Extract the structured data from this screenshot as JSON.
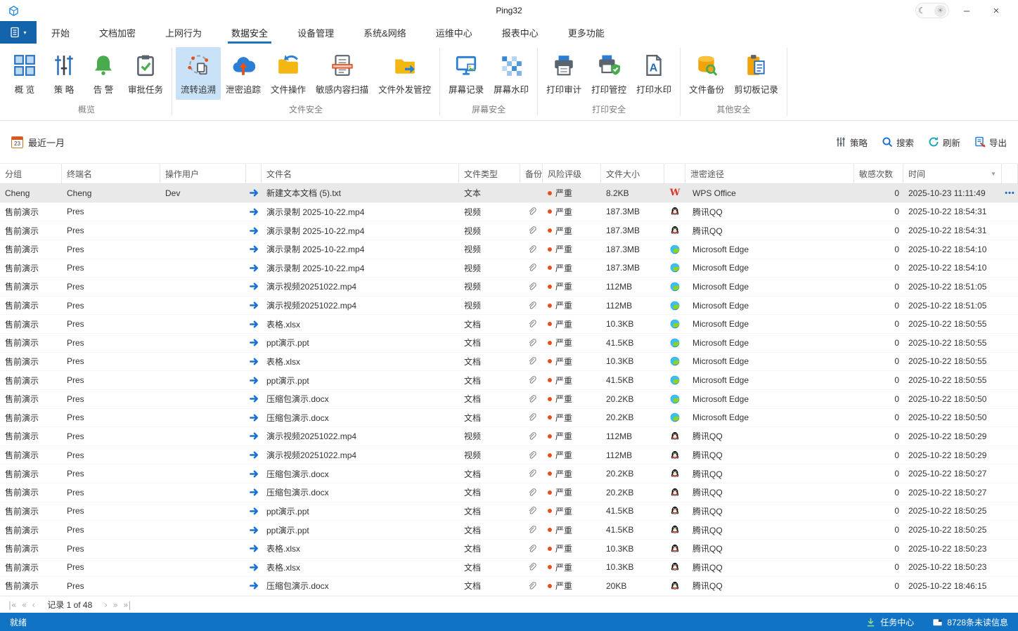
{
  "window": {
    "title": "Ping32",
    "minimize_glyph": "–",
    "close_glyph": "×"
  },
  "tabs": [
    {
      "label": "开始"
    },
    {
      "label": "文档加密"
    },
    {
      "label": "上网行为"
    },
    {
      "label": "数据安全",
      "active": true
    },
    {
      "label": "设备管理"
    },
    {
      "label": "系统&网络"
    },
    {
      "label": "运维中心"
    },
    {
      "label": "报表中心"
    },
    {
      "label": "更多功能"
    }
  ],
  "ribbon": {
    "groups": [
      {
        "name": "概览",
        "buttons": [
          {
            "label": "概 览",
            "icon": "overview-grid-icon"
          },
          {
            "label": "策 略",
            "icon": "policy-sliders-icon"
          },
          {
            "label": "告 警",
            "icon": "alert-bell-icon"
          },
          {
            "label": "审批任务",
            "icon": "approval-tasks-icon"
          }
        ]
      },
      {
        "name": "文件安全",
        "buttons": [
          {
            "label": "流转追溯",
            "icon": "flow-trace-icon",
            "selected": true
          },
          {
            "label": "泄密追踪",
            "icon": "leak-trace-icon"
          },
          {
            "label": "文件操作",
            "icon": "file-operations-icon"
          },
          {
            "label": "敏感内容扫描",
            "icon": "sensitive-scan-icon"
          },
          {
            "label": "文件外发管控",
            "icon": "file-outgoing-icon"
          }
        ]
      },
      {
        "name": "屏幕安全",
        "buttons": [
          {
            "label": "屏幕记录",
            "icon": "screen-record-icon"
          },
          {
            "label": "屏幕水印",
            "icon": "screen-watermark-icon"
          }
        ]
      },
      {
        "name": "打印安全",
        "buttons": [
          {
            "label": "打印审计",
            "icon": "print-audit-icon"
          },
          {
            "label": "打印管控",
            "icon": "print-control-icon"
          },
          {
            "label": "打印水印",
            "icon": "print-watermark-icon"
          }
        ]
      },
      {
        "name": "其他安全",
        "buttons": [
          {
            "label": "文件备份",
            "icon": "file-backup-icon"
          },
          {
            "label": "剪切板记录",
            "icon": "clipboard-record-icon"
          }
        ]
      }
    ]
  },
  "filter_bar": {
    "calendar_day": "23",
    "date_range": "最近一月",
    "actions": [
      {
        "label": "策略",
        "icon": "policy-filter-icon"
      },
      {
        "label": "搜索",
        "icon": "search-icon"
      },
      {
        "label": "刷新",
        "icon": "refresh-icon"
      },
      {
        "label": "导出",
        "icon": "export-icon"
      }
    ]
  },
  "table": {
    "columns": [
      {
        "label": "分组"
      },
      {
        "label": "终端名"
      },
      {
        "label": "操作用户"
      },
      {
        "label": ""
      },
      {
        "label": "文件名"
      },
      {
        "label": "文件类型"
      },
      {
        "label": "备份"
      },
      {
        "label": "风险评级"
      },
      {
        "label": "文件大小"
      },
      {
        "label": ""
      },
      {
        "label": "泄密途径"
      },
      {
        "label": "敏感次数"
      },
      {
        "label": "时间",
        "filter": true
      },
      {
        "label": ""
      }
    ],
    "rows": [
      {
        "group": "Cheng",
        "terminal": "Cheng",
        "user": "Dev",
        "file": "新建文本文档 (5).txt",
        "type": "文本",
        "backup": false,
        "risk": "严重",
        "size": "8.2KB",
        "channel": "WPS Office",
        "channel_icon": "wps-office-icon",
        "count": "0",
        "time": "2025-10-23 11:11:49",
        "selected": true,
        "more": true
      },
      {
        "group": "售前演示",
        "terminal": "Pres",
        "user": "",
        "file": "演示录制 2025-10-22.mp4",
        "type": "视频",
        "backup": true,
        "risk": "严重",
        "size": "187.3MB",
        "channel": "腾讯QQ",
        "channel_icon": "qq-icon",
        "count": "0",
        "time": "2025-10-22 18:54:31"
      },
      {
        "group": "售前演示",
        "terminal": "Pres",
        "user": "",
        "file": "演示录制 2025-10-22.mp4",
        "type": "视频",
        "backup": true,
        "risk": "严重",
        "size": "187.3MB",
        "channel": "腾讯QQ",
        "channel_icon": "qq-icon",
        "count": "0",
        "time": "2025-10-22 18:54:31"
      },
      {
        "group": "售前演示",
        "terminal": "Pres",
        "user": "",
        "file": "演示录制 2025-10-22.mp4",
        "type": "视频",
        "backup": true,
        "risk": "严重",
        "size": "187.3MB",
        "channel": "Microsoft Edge",
        "channel_icon": "edge-icon",
        "count": "0",
        "time": "2025-10-22 18:54:10"
      },
      {
        "group": "售前演示",
        "terminal": "Pres",
        "user": "",
        "file": "演示录制 2025-10-22.mp4",
        "type": "视频",
        "backup": true,
        "risk": "严重",
        "size": "187.3MB",
        "channel": "Microsoft Edge",
        "channel_icon": "edge-icon",
        "count": "0",
        "time": "2025-10-22 18:54:10"
      },
      {
        "group": "售前演示",
        "terminal": "Pres",
        "user": "",
        "file": "演示视频20251022.mp4",
        "type": "视频",
        "backup": true,
        "risk": "严重",
        "size": "112MB",
        "channel": "Microsoft Edge",
        "channel_icon": "edge-icon",
        "count": "0",
        "time": "2025-10-22 18:51:05"
      },
      {
        "group": "售前演示",
        "terminal": "Pres",
        "user": "",
        "file": "演示视频20251022.mp4",
        "type": "视频",
        "backup": true,
        "risk": "严重",
        "size": "112MB",
        "channel": "Microsoft Edge",
        "channel_icon": "edge-icon",
        "count": "0",
        "time": "2025-10-22 18:51:05"
      },
      {
        "group": "售前演示",
        "terminal": "Pres",
        "user": "",
        "file": "表格.xlsx",
        "type": "文档",
        "backup": true,
        "risk": "严重",
        "size": "10.3KB",
        "channel": "Microsoft Edge",
        "channel_icon": "edge-icon",
        "count": "0",
        "time": "2025-10-22 18:50:55"
      },
      {
        "group": "售前演示",
        "terminal": "Pres",
        "user": "",
        "file": "ppt演示.ppt",
        "type": "文档",
        "backup": true,
        "risk": "严重",
        "size": "41.5KB",
        "channel": "Microsoft Edge",
        "channel_icon": "edge-icon",
        "count": "0",
        "time": "2025-10-22 18:50:55"
      },
      {
        "group": "售前演示",
        "terminal": "Pres",
        "user": "",
        "file": "表格.xlsx",
        "type": "文档",
        "backup": true,
        "risk": "严重",
        "size": "10.3KB",
        "channel": "Microsoft Edge",
        "channel_icon": "edge-icon",
        "count": "0",
        "time": "2025-10-22 18:50:55"
      },
      {
        "group": "售前演示",
        "terminal": "Pres",
        "user": "",
        "file": "ppt演示.ppt",
        "type": "文档",
        "backup": true,
        "risk": "严重",
        "size": "41.5KB",
        "channel": "Microsoft Edge",
        "channel_icon": "edge-icon",
        "count": "0",
        "time": "2025-10-22 18:50:55"
      },
      {
        "group": "售前演示",
        "terminal": "Pres",
        "user": "",
        "file": "压缩包演示.docx",
        "type": "文档",
        "backup": true,
        "risk": "严重",
        "size": "20.2KB",
        "channel": "Microsoft Edge",
        "channel_icon": "edge-icon",
        "count": "0",
        "time": "2025-10-22 18:50:50"
      },
      {
        "group": "售前演示",
        "terminal": "Pres",
        "user": "",
        "file": "压缩包演示.docx",
        "type": "文档",
        "backup": true,
        "risk": "严重",
        "size": "20.2KB",
        "channel": "Microsoft Edge",
        "channel_icon": "edge-icon",
        "count": "0",
        "time": "2025-10-22 18:50:50"
      },
      {
        "group": "售前演示",
        "terminal": "Pres",
        "user": "",
        "file": "演示视频20251022.mp4",
        "type": "视频",
        "backup": true,
        "risk": "严重",
        "size": "112MB",
        "channel": "腾讯QQ",
        "channel_icon": "qq-icon",
        "count": "0",
        "time": "2025-10-22 18:50:29"
      },
      {
        "group": "售前演示",
        "terminal": "Pres",
        "user": "",
        "file": "演示视频20251022.mp4",
        "type": "视频",
        "backup": true,
        "risk": "严重",
        "size": "112MB",
        "channel": "腾讯QQ",
        "channel_icon": "qq-icon",
        "count": "0",
        "time": "2025-10-22 18:50:29"
      },
      {
        "group": "售前演示",
        "terminal": "Pres",
        "user": "",
        "file": "压缩包演示.docx",
        "type": "文档",
        "backup": true,
        "risk": "严重",
        "size": "20.2KB",
        "channel": "腾讯QQ",
        "channel_icon": "qq-icon",
        "count": "0",
        "time": "2025-10-22 18:50:27"
      },
      {
        "group": "售前演示",
        "terminal": "Pres",
        "user": "",
        "file": "压缩包演示.docx",
        "type": "文档",
        "backup": true,
        "risk": "严重",
        "size": "20.2KB",
        "channel": "腾讯QQ",
        "channel_icon": "qq-icon",
        "count": "0",
        "time": "2025-10-22 18:50:27"
      },
      {
        "group": "售前演示",
        "terminal": "Pres",
        "user": "",
        "file": "ppt演示.ppt",
        "type": "文档",
        "backup": true,
        "risk": "严重",
        "size": "41.5KB",
        "channel": "腾讯QQ",
        "channel_icon": "qq-icon",
        "count": "0",
        "time": "2025-10-22 18:50:25"
      },
      {
        "group": "售前演示",
        "terminal": "Pres",
        "user": "",
        "file": "ppt演示.ppt",
        "type": "文档",
        "backup": true,
        "risk": "严重",
        "size": "41.5KB",
        "channel": "腾讯QQ",
        "channel_icon": "qq-icon",
        "count": "0",
        "time": "2025-10-22 18:50:25"
      },
      {
        "group": "售前演示",
        "terminal": "Pres",
        "user": "",
        "file": "表格.xlsx",
        "type": "文档",
        "backup": true,
        "risk": "严重",
        "size": "10.3KB",
        "channel": "腾讯QQ",
        "channel_icon": "qq-icon",
        "count": "0",
        "time": "2025-10-22 18:50:23"
      },
      {
        "group": "售前演示",
        "terminal": "Pres",
        "user": "",
        "file": "表格.xlsx",
        "type": "文档",
        "backup": true,
        "risk": "严重",
        "size": "10.3KB",
        "channel": "腾讯QQ",
        "channel_icon": "qq-icon",
        "count": "0",
        "time": "2025-10-22 18:50:23"
      },
      {
        "group": "售前演示",
        "terminal": "Pres",
        "user": "",
        "file": "压缩包演示.docx",
        "type": "文档",
        "backup": true,
        "risk": "严重",
        "size": "20KB",
        "channel": "腾讯QQ",
        "channel_icon": "qq-icon",
        "count": "0",
        "time": "2025-10-22 18:46:15"
      }
    ]
  },
  "pagination": {
    "record_text": "记录 1 of 48",
    "left_buttons": [
      "first-page-icon",
      "prev-jump-icon",
      "prev-page-icon"
    ],
    "right_buttons": [
      "next-page-icon",
      "next-jump-icon",
      "last-page-icon"
    ]
  },
  "status_bar": {
    "left": "就绪",
    "task_center": "任务中心",
    "unread": "8728条未读信息"
  },
  "colors": {
    "accent_blue": "#1464ac",
    "tab_underline": "#1b74c8",
    "ribbon_selected_bg": "#c9e2f7",
    "severity_dot": "#e2511e",
    "status_bar_bg": "#1173c4",
    "selected_row_bg": "#e9e9e9"
  }
}
